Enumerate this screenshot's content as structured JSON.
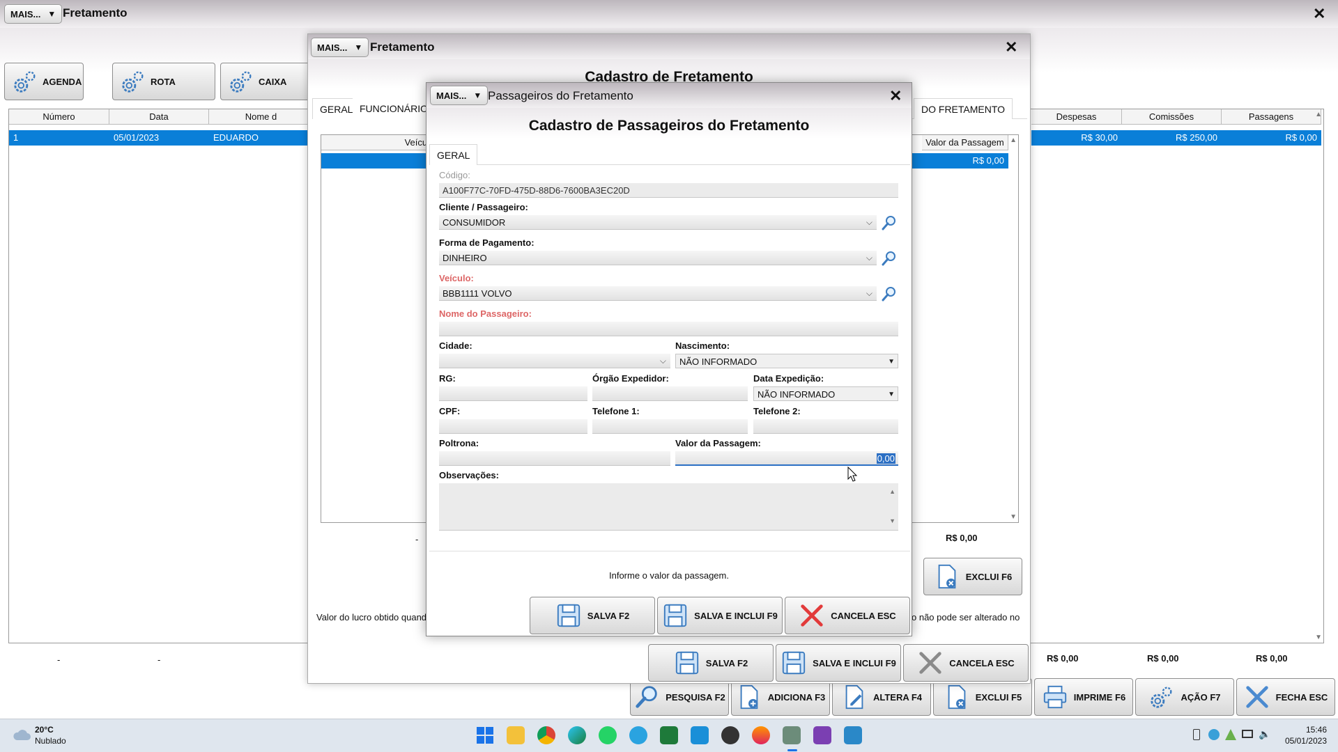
{
  "main": {
    "mais_label": "MAIS...",
    "title": "Fretamento",
    "close": "✕",
    "toolbar": [
      {
        "label": "AGENDA"
      },
      {
        "label": "ROTA"
      },
      {
        "label": "CAIXA"
      }
    ],
    "grid": {
      "headers_left": [
        "Número",
        "Data",
        "Nome d"
      ],
      "headers_right": [
        "Despesas",
        "Comissões",
        "Passagens"
      ],
      "row": {
        "numero": "1",
        "data": "05/01/2023",
        "nome": "EDUARDO",
        "despesas": "R$ 30,00",
        "comissoes": "R$ 250,00",
        "passagens": "R$ 0,00"
      }
    },
    "footer": {
      "dash1": "-",
      "dash2": "-",
      "despesas": "R$ 0,00",
      "comissoes": "R$ 0,00",
      "passagens": "R$ 0,00"
    },
    "bottom_buttons": [
      {
        "label": "PESQUISA F2"
      },
      {
        "label": "ADICIONA F3"
      },
      {
        "label": "ALTERA F4"
      },
      {
        "label": "EXCLUI F5"
      },
      {
        "label": "IMPRIME F6"
      },
      {
        "label": "AÇÃO F7"
      },
      {
        "label": "FECHA ESC"
      }
    ]
  },
  "fretamento": {
    "mais_label": "MAIS...",
    "title": "Fretamento",
    "close": "✕",
    "heading": "Cadastro de Fretamento",
    "tabs": [
      "GERAL",
      "FUNCIONÁRIOS/",
      "DO FRETAMENTO"
    ],
    "grid_headers": [
      "Veícul",
      "Valor da Passagem"
    ],
    "grid_row_value": "R$ 0,00",
    "total_value": "R$ 0,00",
    "dash": "-",
    "exclui_label": "EXCLUI F6",
    "info_left": "Valor do lucro obtido quand",
    "info_right": "o não pode ser alterado no",
    "buttons": [
      {
        "label": "SALVA F2"
      },
      {
        "label": "SALVA E INCLUI F9"
      },
      {
        "label": "CANCELA ESC"
      }
    ]
  },
  "passageiros": {
    "mais_label": "MAIS...",
    "title": "Passageiros do Fretamento",
    "close": "✕",
    "heading": "Cadastro de Passageiros do Fretamento",
    "tab": "GERAL",
    "fields": {
      "codigo_label": "Código:",
      "codigo_value": "A100F77C-70FD-475D-88D6-7600BA3EC20D",
      "cliente_label": "Cliente / Passageiro:",
      "cliente_value": "CONSUMIDOR",
      "pagamento_label": "Forma de Pagamento:",
      "pagamento_value": "DINHEIRO",
      "veiculo_label": "Veículo:",
      "veiculo_value": "BBB1111 VOLVO",
      "nome_label": "Nome do Passageiro:",
      "nome_value": "",
      "cidade_label": "Cidade:",
      "cidade_value": "",
      "nascimento_label": "Nascimento:",
      "nascimento_value": "NÃO INFORMADO",
      "rg_label": "RG:",
      "orgao_label": "Órgão Expedidor:",
      "data_exp_label": "Data Expedição:",
      "data_exp_value": "NÃO INFORMADO",
      "cpf_label": "CPF:",
      "tel1_label": "Telefone 1:",
      "tel2_label": "Telefone 2:",
      "poltrona_label": "Poltrona:",
      "valor_label": "Valor da Passagem:",
      "valor_value": "0,00",
      "obs_label": "Observações:"
    },
    "hint": "Informe o valor da passagem.",
    "buttons": [
      {
        "label": "SALVA F2"
      },
      {
        "label": "SALVA E INCLUI F9"
      },
      {
        "label": "CANCELA ESC"
      }
    ]
  },
  "taskbar": {
    "temp": "20°C",
    "weather": "Nublado",
    "time": "15:46",
    "date": "05/01/2023"
  }
}
